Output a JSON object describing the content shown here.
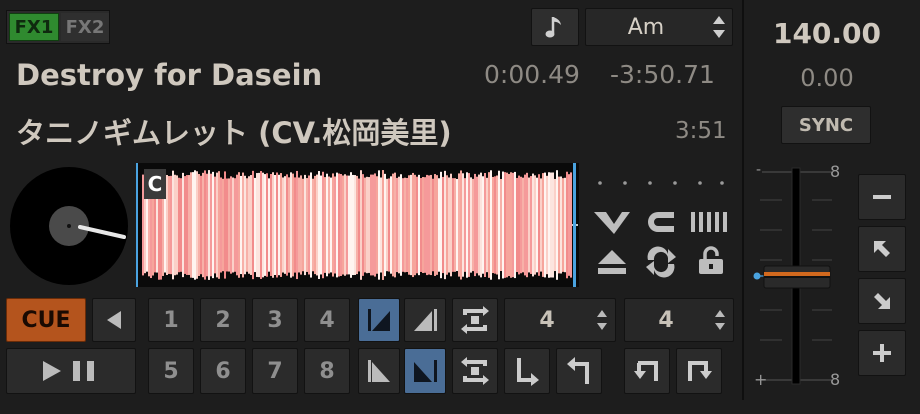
{
  "fx": {
    "fx1_label": "FX1",
    "fx2_label": "FX2"
  },
  "track": {
    "title": "Destroy for Dasein",
    "artist": "タニノギムレット (CV.松岡美里)",
    "elapsed": "0:00.49",
    "remaining": "-3:50.71",
    "duration": "3:51"
  },
  "key": {
    "note_icon": "music-note-icon",
    "value": "Am"
  },
  "rate": {
    "bpm": "140.00",
    "offset": "0.00",
    "sync_label": "SYNC"
  },
  "waveform": {
    "cue_marker": "C"
  },
  "pitch_fader": {
    "top_label": "8",
    "bottom_label": "8",
    "top_sign": "-",
    "bottom_sign": "+"
  },
  "transport": {
    "cue_label": "CUE"
  },
  "hotcues": [
    "1",
    "2",
    "3",
    "4",
    "5",
    "6",
    "7",
    "8"
  ],
  "loop": {
    "beatloop_size": "4",
    "beatjump_size": "4"
  },
  "colors": {
    "accent_blue": "#4a6d96",
    "cue_orange": "#b4541d",
    "fx_green": "#2f8a2f",
    "waveform_pink": "#f59a9a"
  }
}
